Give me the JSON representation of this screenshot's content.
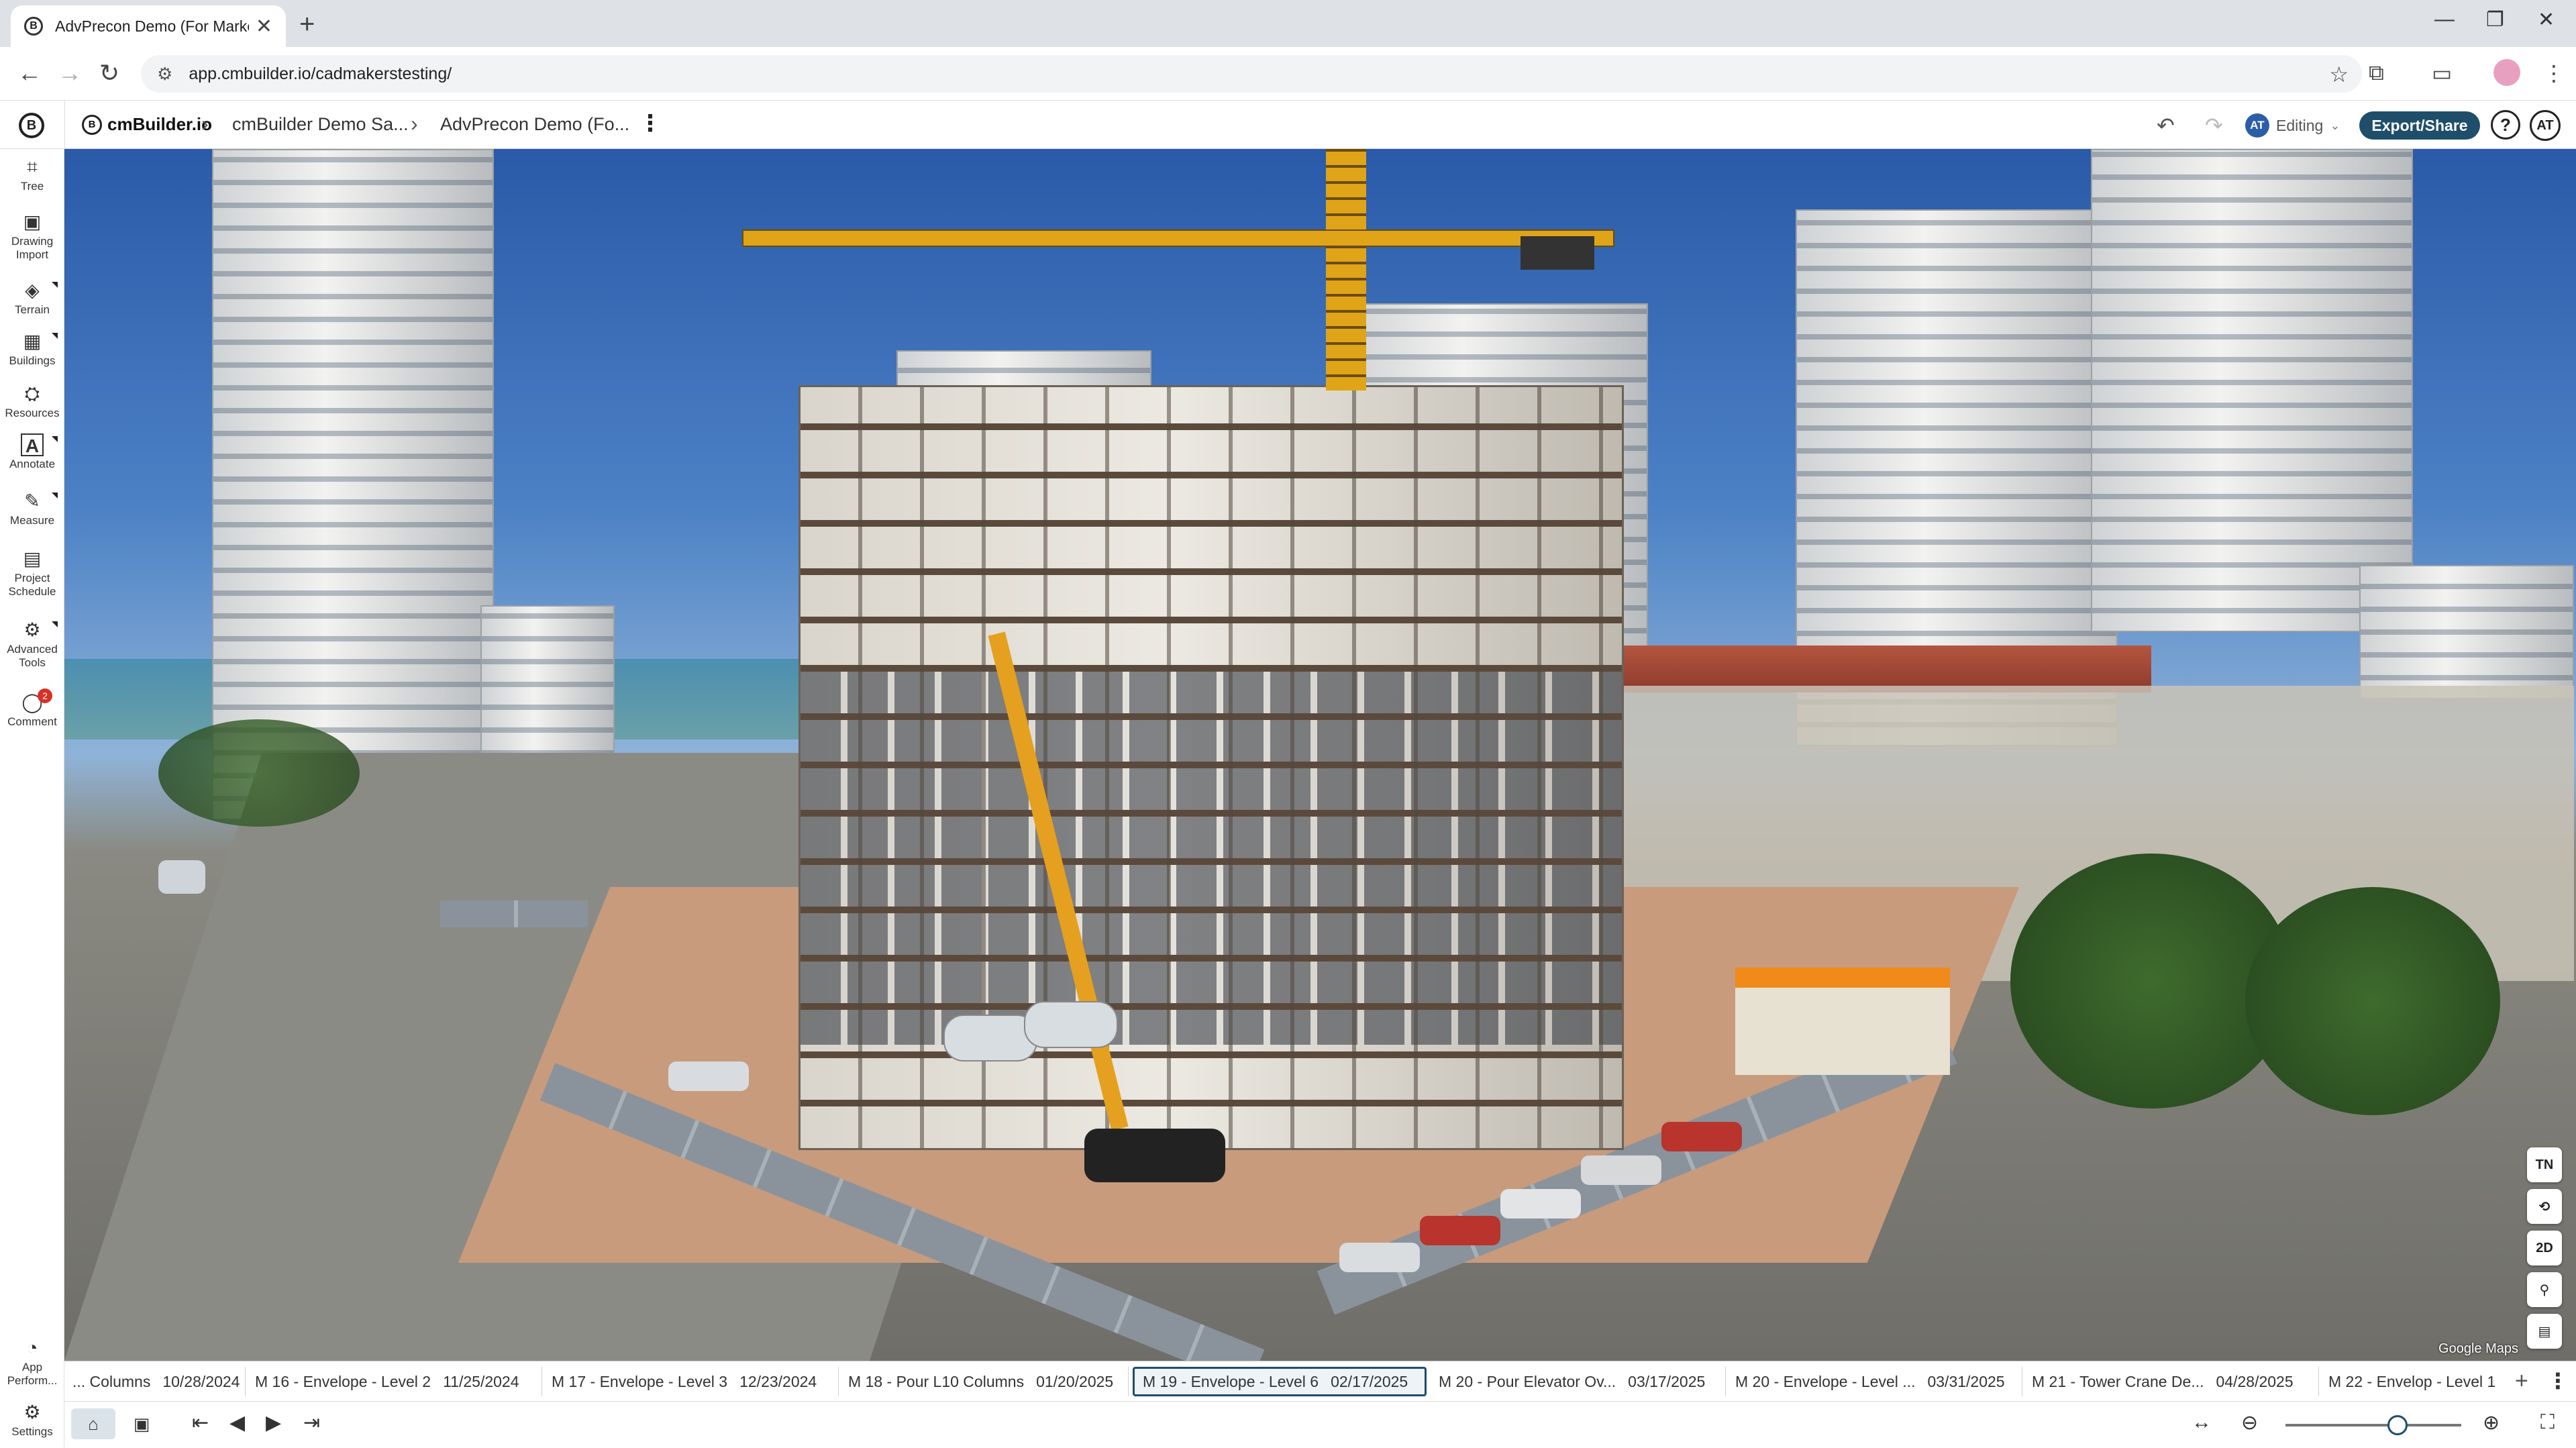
{
  "browser": {
    "tab_title": "AdvPrecon Demo (For Marketin",
    "tab_close": "✕",
    "new_tab": "+",
    "url": "app.cmbuilder.io/cadmakerstesting/"
  },
  "header": {
    "logo_letter": "B",
    "brand": "cmBuilder.io",
    "breadcrumbs": [
      "cmBuilder Demo Sa...",
      "AdvPrecon Demo (Fo..."
    ],
    "editing_user": "AT",
    "editing_label": "Editing",
    "export_label": "Export/Share",
    "help": "?",
    "user_initials": "AT"
  },
  "tools": {
    "items": [
      {
        "label": "Tree",
        "icon": "⌗",
        "has_menu": false
      },
      {
        "label": "Drawing\nImport",
        "icon": "▣",
        "has_menu": false
      },
      {
        "label": "Terrain",
        "icon": "◈",
        "has_menu": true
      },
      {
        "label": "Buildings",
        "icon": "▦",
        "has_menu": true
      },
      {
        "label": "Resources",
        "icon": "⛭",
        "has_menu": false
      },
      {
        "label": "Annotate",
        "icon": "A",
        "has_menu": true
      },
      {
        "label": "Measure",
        "icon": "✎",
        "has_menu": true
      },
      {
        "label": "Project\nSchedule",
        "icon": "▤",
        "has_menu": false
      },
      {
        "label": "Advanced\nTools",
        "icon": "⚙",
        "has_menu": true
      },
      {
        "label": "Comment",
        "icon": "◯",
        "has_menu": false,
        "badge": "2"
      }
    ],
    "bottom": [
      {
        "label": "App\nPerform...",
        "icon": "◔"
      },
      {
        "label": "Settings",
        "icon": "⚙"
      }
    ]
  },
  "viewport": {
    "attribution": "Google Maps",
    "view_tools": [
      "TN",
      "⟲",
      "2D",
      "⚲",
      "▤"
    ]
  },
  "timeline": {
    "milestones": [
      {
        "name": "... Columns",
        "date": "10/28/2024"
      },
      {
        "name": "M 16 - Envelope - Level 2",
        "date": "11/25/2024"
      },
      {
        "name": "M 17 - Envelope - Level 3",
        "date": "12/23/2024"
      },
      {
        "name": "M 18 - Pour L10 Columns",
        "date": "01/20/2025"
      },
      {
        "name": "M 19 - Envelope - Level 6",
        "date": "02/17/2025"
      },
      {
        "name": "M 20 - Pour Elevator Ov...",
        "date": "03/17/2025"
      },
      {
        "name": "M 20 - Envelope - Level ...",
        "date": "03/31/2025"
      },
      {
        "name": "M 21 - Tower Crane De...",
        "date": "04/28/2025"
      },
      {
        "name": "M 22 - Envelop - Level 1",
        "date": ""
      }
    ],
    "active_index": 4,
    "add": "+",
    "more": "⋮"
  }
}
